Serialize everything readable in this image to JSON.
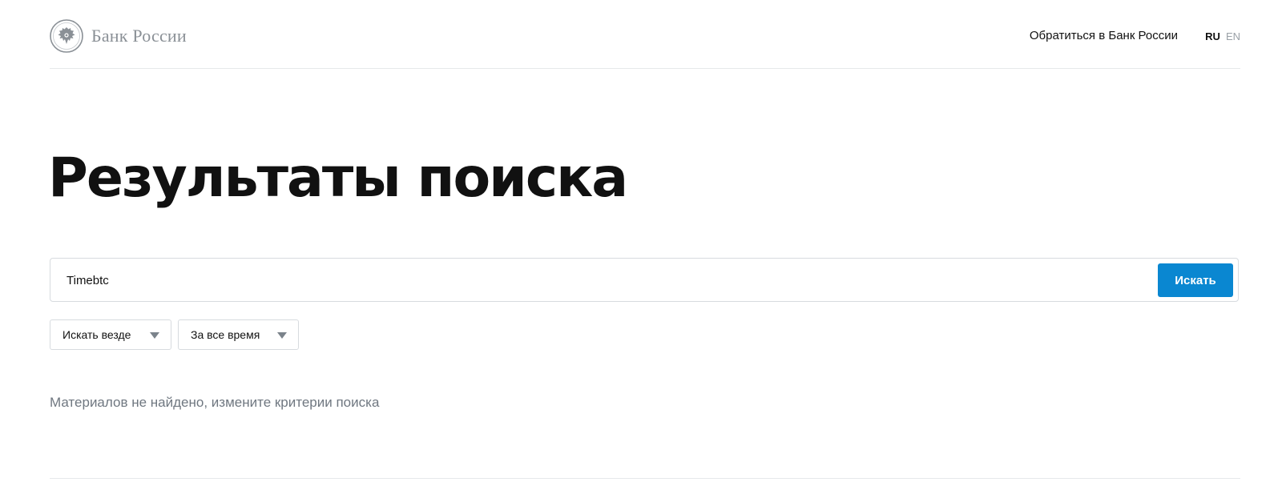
{
  "header": {
    "logo_text": "Банк России",
    "contact_link": "Обратиться в Банк России",
    "lang_ru": "RU",
    "lang_en": "EN"
  },
  "main": {
    "title": "Результаты поиска",
    "search": {
      "value": "Timebtc",
      "button_label": "Искать"
    },
    "filters": [
      {
        "label": "Искать везде",
        "icon": "chevron-down-icon"
      },
      {
        "label": "За все время",
        "icon": "chevron-down-icon"
      }
    ],
    "empty_message": "Материалов не найдено, измените критерии поиска"
  },
  "colors": {
    "accent": "#0a87d1",
    "muted_text": "#6f7780",
    "border": "#d7dbdf"
  }
}
